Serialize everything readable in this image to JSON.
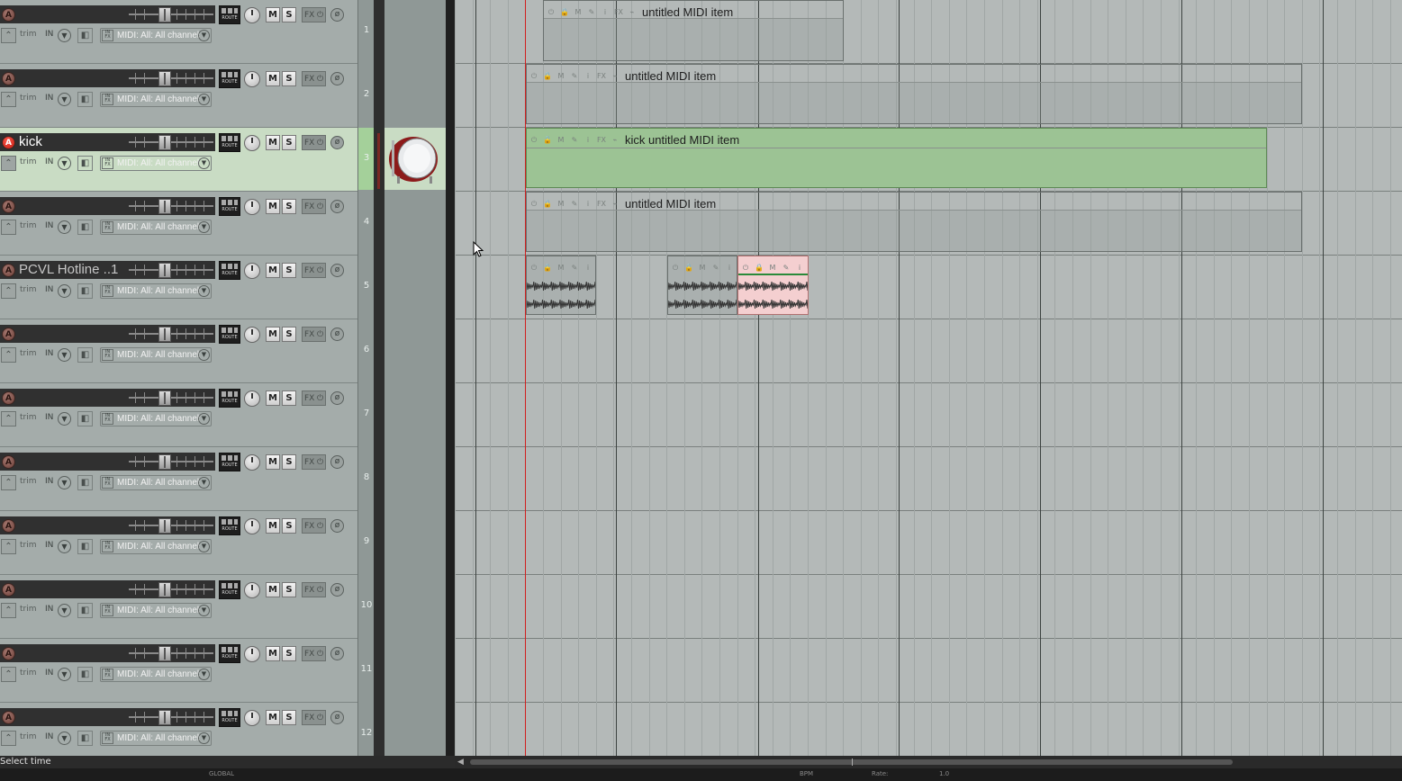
{
  "tracks": [
    {
      "num": "1",
      "name": "",
      "armed": false,
      "selected": false,
      "arm_label": "A",
      "midi_input": "MIDI: All: All channels"
    },
    {
      "num": "2",
      "name": "",
      "armed": false,
      "selected": false,
      "arm_label": "A",
      "midi_input": "MIDI: All: All channels"
    },
    {
      "num": "3",
      "name": "kick",
      "armed": true,
      "selected": true,
      "arm_label": "A",
      "midi_input": "MIDI: All: All channels"
    },
    {
      "num": "4",
      "name": "",
      "armed": false,
      "selected": false,
      "arm_label": "A",
      "midi_input": "MIDI: All: All channels"
    },
    {
      "num": "5",
      "name": "PCVL Hotline ..1",
      "armed": false,
      "selected": false,
      "arm_label": "A",
      "midi_input": "MIDI: All: All channels"
    },
    {
      "num": "6",
      "name": "",
      "armed": false,
      "selected": false,
      "arm_label": "A",
      "midi_input": "MIDI: All: All channels"
    },
    {
      "num": "7",
      "name": "",
      "armed": false,
      "selected": false,
      "arm_label": "A",
      "midi_input": "MIDI: All: All channels"
    },
    {
      "num": "8",
      "name": "",
      "armed": false,
      "selected": false,
      "arm_label": "A",
      "midi_input": "MIDI: All: All channels"
    },
    {
      "num": "9",
      "name": "",
      "armed": false,
      "selected": false,
      "arm_label": "A",
      "midi_input": "MIDI: All: All channels"
    },
    {
      "num": "10",
      "name": "",
      "armed": false,
      "selected": false,
      "arm_label": "A",
      "midi_input": "MIDI: All: All channels"
    },
    {
      "num": "11",
      "name": "",
      "armed": false,
      "selected": false,
      "arm_label": "A",
      "midi_input": "MIDI: All: All channels"
    },
    {
      "num": "12",
      "name": "",
      "armed": false,
      "selected": false,
      "arm_label": "A",
      "midi_input": "MIDI: All: All channels"
    }
  ],
  "labels": {
    "route": "ROUTE",
    "mute": "M",
    "solo": "S",
    "fx": "FX",
    "trim": "trim",
    "input": "IN",
    "midi_icon": "IN FX",
    "item_fx": "FX",
    "item_info": "i"
  },
  "items": [
    {
      "title": "untitled MIDI item"
    },
    {
      "title": "untitled MIDI item"
    },
    {
      "title": "kick untitled MIDI item"
    },
    {
      "title": "untitled MIDI item"
    }
  ],
  "status": "Select time",
  "transport": {
    "global": "GLOBAL",
    "bpm_label": "BPM",
    "rate_label": "Rate:",
    "rate_value": "1.0"
  },
  "colors": {
    "selected_track": "#c9dcc4",
    "record_arm": "#e0241a",
    "play_cursor": "#d02020",
    "midi_item_selected": "#9cc394",
    "audio_item_selected": "#f4cfd0"
  }
}
